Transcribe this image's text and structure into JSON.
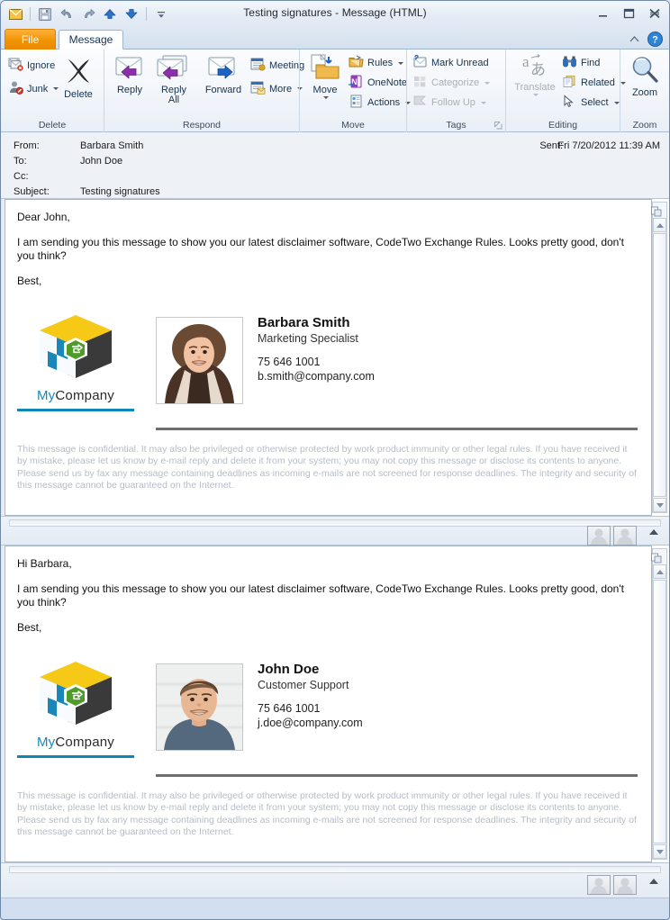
{
  "window": {
    "title": "Testing signatures  -  Message (HTML)",
    "quick_access": [
      {
        "name": "envelope-icon",
        "label": "Message"
      },
      {
        "name": "save-icon",
        "label": "Save"
      },
      {
        "name": "undo-icon",
        "label": "Undo"
      },
      {
        "name": "redo-icon",
        "label": "Redo"
      },
      {
        "name": "previous-item-icon",
        "label": "Previous Item"
      },
      {
        "name": "next-item-icon",
        "label": "Next Item"
      },
      {
        "name": "customize-quick-access-icon",
        "label": "Customize Quick Access Toolbar"
      }
    ],
    "controls": [
      {
        "name": "minimize-button",
        "label": "Minimize"
      },
      {
        "name": "maximize-button",
        "label": "Maximize"
      },
      {
        "name": "close-button",
        "label": "Close"
      }
    ]
  },
  "tabs": {
    "file_label": "File",
    "message_label": "Message",
    "minimize_ribbon_label": "Minimize the Ribbon",
    "help_label": "?"
  },
  "ribbon": {
    "groups": [
      {
        "name": "delete",
        "label": "Delete",
        "items": [
          {
            "name": "ignore-button",
            "label": "Ignore",
            "icon": "ignore-icon",
            "disabled": false,
            "dropdown": false
          },
          {
            "name": "junk-button",
            "label": "Junk",
            "icon": "junk-icon",
            "disabled": false,
            "dropdown": true
          },
          {
            "name": "delete-button",
            "label": "Delete",
            "icon": "delete-x-icon",
            "disabled": false,
            "dropdown": false
          }
        ]
      },
      {
        "name": "respond",
        "label": "Respond",
        "items": [
          {
            "name": "reply-button",
            "label": "Reply",
            "icon": "reply-icon",
            "disabled": false,
            "dropdown": false
          },
          {
            "name": "reply-all-button",
            "label": "Reply\nAll",
            "icon": "reply-all-icon",
            "disabled": false,
            "dropdown": false
          },
          {
            "name": "forward-button",
            "label": "Forward",
            "icon": "forward-icon",
            "disabled": false,
            "dropdown": false
          },
          {
            "name": "meeting-button",
            "label": "Meeting",
            "icon": "meeting-icon",
            "disabled": false,
            "dropdown": false
          },
          {
            "name": "more-button",
            "label": "More",
            "icon": "more-respond-icon",
            "disabled": false,
            "dropdown": true
          }
        ]
      },
      {
        "name": "move",
        "label": "Move",
        "items": [
          {
            "name": "move-button",
            "label": "Move",
            "icon": "move-folder-icon",
            "disabled": false,
            "dropdown": true
          },
          {
            "name": "rules-button",
            "label": "Rules",
            "icon": "rules-icon",
            "disabled": false,
            "dropdown": true
          },
          {
            "name": "onenote-button",
            "label": "OneNote",
            "icon": "onenote-icon",
            "disabled": false,
            "dropdown": false
          },
          {
            "name": "actions-button",
            "label": "Actions",
            "icon": "actions-icon",
            "disabled": false,
            "dropdown": true
          }
        ]
      },
      {
        "name": "tags",
        "label": "Tags",
        "items": [
          {
            "name": "mark-unread-button",
            "label": "Mark Unread",
            "icon": "mark-unread-icon",
            "disabled": false,
            "dropdown": false
          },
          {
            "name": "categorize-button",
            "label": "Categorize",
            "icon": "categorize-icon",
            "disabled": true,
            "dropdown": true
          },
          {
            "name": "follow-up-button",
            "label": "Follow Up",
            "icon": "follow-up-flag-icon",
            "disabled": true,
            "dropdown": true
          }
        ]
      },
      {
        "name": "editing",
        "label": "Editing",
        "items": [
          {
            "name": "translate-button",
            "label": "Translate",
            "icon": "translate-icon",
            "disabled": true,
            "dropdown": true
          },
          {
            "name": "find-button",
            "label": "Find",
            "icon": "find-binoculars-icon",
            "disabled": false,
            "dropdown": false
          },
          {
            "name": "related-button",
            "label": "Related",
            "icon": "related-icon",
            "disabled": false,
            "dropdown": true
          },
          {
            "name": "select-button",
            "label": "Select",
            "icon": "select-cursor-icon",
            "disabled": false,
            "dropdown": true
          }
        ]
      },
      {
        "name": "zoom",
        "label": "Zoom",
        "items": [
          {
            "name": "zoom-button",
            "label": "Zoom",
            "icon": "zoom-magnifier-icon",
            "disabled": false,
            "dropdown": false
          }
        ]
      }
    ]
  },
  "message_header": {
    "from_label": "From:",
    "from_value": "Barbara Smith",
    "to_label": "To:",
    "to_value": "John Doe",
    "cc_label": "Cc:",
    "cc_value": "",
    "subject_label": "Subject:",
    "subject_value": "Testing signatures",
    "sent_label": "Sent:",
    "sent_value": "Fri 7/20/2012 11:39 AM"
  },
  "pane_top": {
    "greeting": "Dear John,",
    "paragraph": "I am sending you this message to show you our latest disclaimer software, CodeTwo Exchange Rules. Looks pretty good, don't you think?",
    "closing": "Best,",
    "signature": {
      "company_my": "My",
      "company_rest": "Company",
      "photo_alt": "barbara-smith-photo",
      "name": "Barbara Smith",
      "role": "Marketing Specialist",
      "phone": "75 646 1001",
      "email": "b.smith@company.com"
    },
    "disclaimer": "This message is confidential. It may also be privileged or otherwise protected by work product immunity or other legal rules. If you have received it by mistake, please let us know by e-mail reply and delete it from your system; you may not copy this message or disclose its contents to anyone. Please send us by fax any message containing deadlines as incoming e-mails are not screened for response deadlines. The integrity and security of this message cannot be guaranteed on the Internet."
  },
  "pane_bottom": {
    "greeting": "Hi Barbara,",
    "paragraph": "I am sending you this message to show you our latest disclaimer software, CodeTwo Exchange Rules. Looks pretty good, don't you think?",
    "closing": "Best,",
    "signature": {
      "company_my": "My",
      "company_rest": "Company",
      "photo_alt": "john-doe-photo",
      "name": "John Doe",
      "role": "Customer Support",
      "phone": "75 646 1001",
      "email": "j.doe@company.com"
    },
    "disclaimer": "This message is confidential. It may also be privileged or otherwise protected by work product immunity or other legal rules. If you have received it by mistake, please let us know by e-mail reply and delete it from your system; you may not copy this message or disclose its contents to anyone. Please send us by fax any message containing deadlines as incoming e-mails are not screened for response deadlines. The integrity and security of this message cannot be guaranteed on the Internet."
  },
  "people_pane": {
    "avatar_one": "contact-avatar",
    "avatar_two": "contact-avatar",
    "expand_label": "Expand People Pane"
  },
  "colors": {
    "file_tab": "#f29400",
    "logo_yellow": "#f6c917",
    "logo_teal": "#1b87b8",
    "logo_dark": "#3a3a3a",
    "logo_green": "#4f9c2b",
    "rule_teal": "#0f86b6",
    "rule_gray": "#6e6e6e",
    "disclaimer_gray": "#b6bcc6"
  }
}
